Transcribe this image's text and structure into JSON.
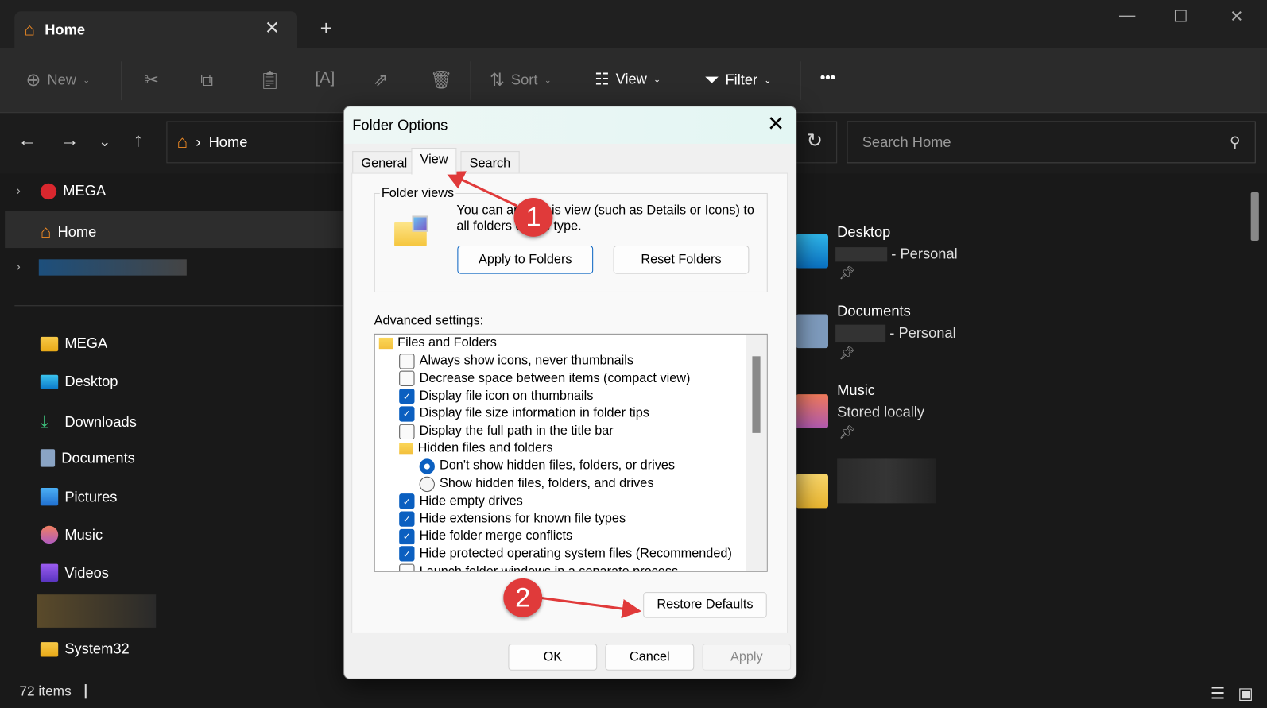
{
  "window": {
    "tab_title": "Home",
    "new_tab": "+",
    "minimize": "—",
    "maximize": "☐",
    "close": "✕"
  },
  "toolbar": {
    "new": "New",
    "sort": "Sort",
    "view": "View",
    "filter": "Filter",
    "more": "•••"
  },
  "address": {
    "crumb": "Home",
    "search_placeholder": "Search Home"
  },
  "sidebar": {
    "top": [
      {
        "label": "MEGA"
      },
      {
        "label": "Home"
      }
    ],
    "pinned": [
      {
        "label": "MEGA"
      },
      {
        "label": "Desktop"
      },
      {
        "label": "Downloads"
      },
      {
        "label": "Documents"
      },
      {
        "label": "Pictures"
      },
      {
        "label": "Music"
      },
      {
        "label": "Videos"
      },
      {
        "label": "System32"
      }
    ]
  },
  "quick_access": [
    {
      "title": "Desktop",
      "sub": "- Personal"
    },
    {
      "title": "Documents",
      "sub": "- Personal"
    },
    {
      "title": "Music",
      "sub": "Stored locally"
    }
  ],
  "status": {
    "items": "72 items"
  },
  "dialog": {
    "title": "Folder Options",
    "tabs": [
      "General",
      "View",
      "Search"
    ],
    "folder_views_label": "Folder views",
    "folder_views_text": "You can apply this view (such as Details or Icons) to all folders of this type.",
    "apply_to_folders": "Apply to Folders",
    "reset_folders": "Reset Folders",
    "advanced_label": "Advanced settings:",
    "tree": [
      {
        "type": "folder",
        "label": "Files and Folders",
        "level": 0
      },
      {
        "type": "check",
        "label": "Always show icons, never thumbnails",
        "checked": false,
        "level": 1
      },
      {
        "type": "check",
        "label": "Decrease space between items (compact view)",
        "checked": false,
        "level": 1
      },
      {
        "type": "check",
        "label": "Display file icon on thumbnails",
        "checked": true,
        "level": 1
      },
      {
        "type": "check",
        "label": "Display file size information in folder tips",
        "checked": true,
        "level": 1
      },
      {
        "type": "check",
        "label": "Display the full path in the title bar",
        "checked": false,
        "level": 1
      },
      {
        "type": "folder",
        "label": "Hidden files and folders",
        "level": 1
      },
      {
        "type": "radio",
        "label": "Don't show hidden files, folders, or drives",
        "checked": true,
        "level": 2
      },
      {
        "type": "radio",
        "label": "Show hidden files, folders, and drives",
        "checked": false,
        "level": 2
      },
      {
        "type": "check",
        "label": "Hide empty drives",
        "checked": true,
        "level": 1
      },
      {
        "type": "check",
        "label": "Hide extensions for known file types",
        "checked": true,
        "level": 1
      },
      {
        "type": "check",
        "label": "Hide folder merge conflicts",
        "checked": true,
        "level": 1
      },
      {
        "type": "check",
        "label": "Hide protected operating system files (Recommended)",
        "checked": true,
        "level": 1
      },
      {
        "type": "check",
        "label": "Launch folder windows in a separate process",
        "checked": false,
        "level": 1
      }
    ],
    "restore_defaults": "Restore Defaults",
    "ok": "OK",
    "cancel": "Cancel",
    "apply": "Apply"
  },
  "annotations": {
    "step1": "1",
    "step2": "2",
    "color": "#e03a3a"
  }
}
